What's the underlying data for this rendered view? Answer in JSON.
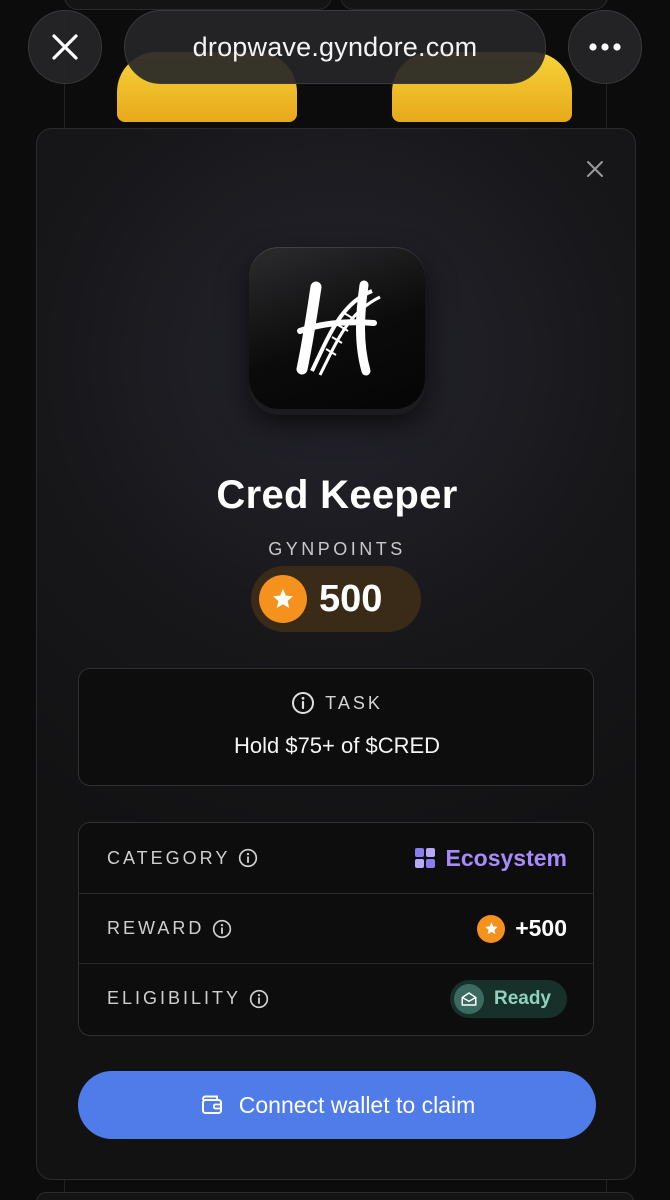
{
  "browser": {
    "url": "dropwave.gyndore.com",
    "close_icon": "close-icon",
    "more_icon": "more-dots-icon"
  },
  "modal": {
    "close_icon": "close-icon",
    "app_icon": "dna-h-logo-icon",
    "title": "Cred Keeper",
    "points_label": "GYNPOINTS",
    "points_value": "500",
    "task": {
      "label": "TASK",
      "text": "Hold $75+ of $CRED"
    },
    "rows": [
      {
        "label": "CATEGORY",
        "value": "Ecosystem",
        "icon": "grid-squares-icon"
      },
      {
        "label": "REWARD",
        "value": "+500",
        "icon": "star-coin-icon"
      },
      {
        "label": "ELIGIBILITY",
        "value": "Ready",
        "icon": "envelope-open-icon"
      }
    ],
    "cta_label": "Connect wallet to claim",
    "cta_icon": "wallet-icon"
  },
  "colors": {
    "accent_blue": "#4f7ce8",
    "coin_orange": "#f5921e",
    "category_purple": "#a78bfa",
    "ready_green": "#8fd3be"
  }
}
